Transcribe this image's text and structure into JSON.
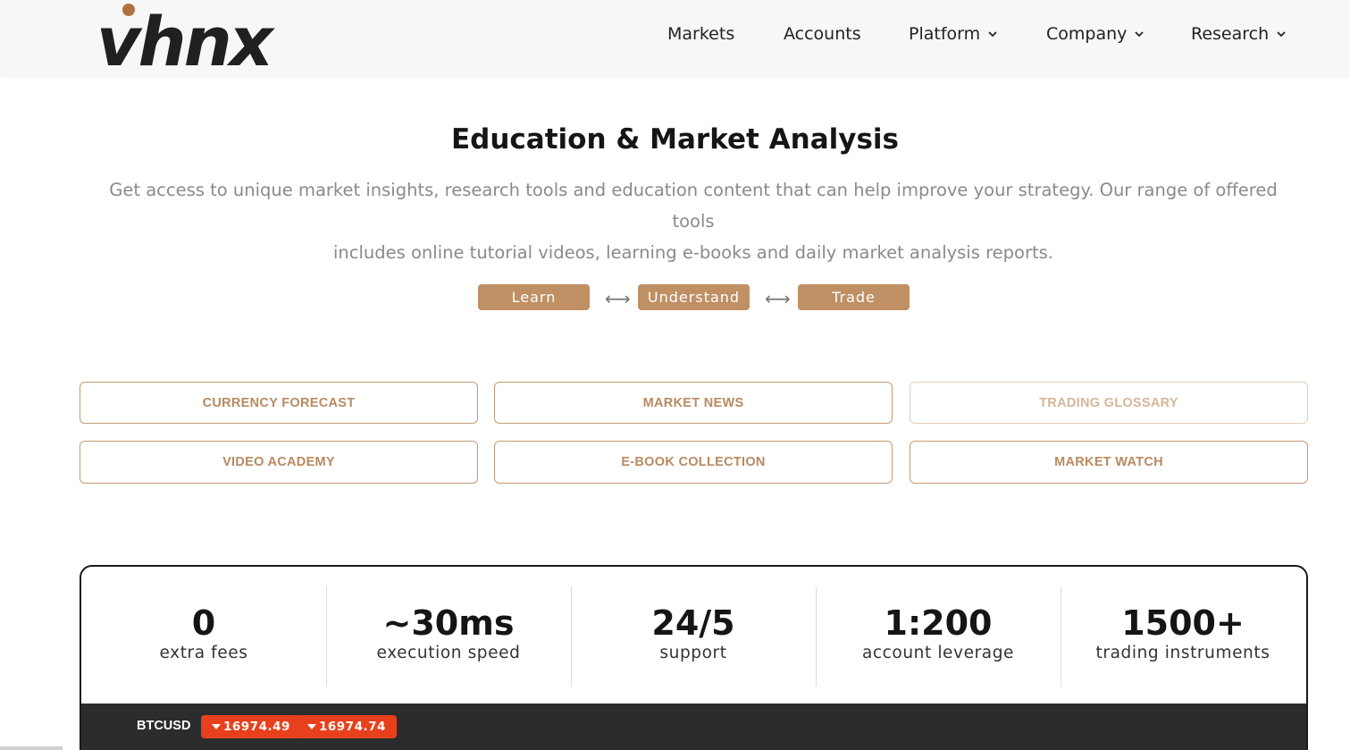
{
  "brand": {
    "logo_text": "vhnx",
    "accent": "#bf9064",
    "dot_color": "#b07040"
  },
  "nav": {
    "items": [
      {
        "label": "Markets",
        "has_dropdown": false
      },
      {
        "label": "Accounts",
        "has_dropdown": false
      },
      {
        "label": "Platform",
        "has_dropdown": true
      },
      {
        "label": "Company",
        "has_dropdown": true
      },
      {
        "label": "Research",
        "has_dropdown": true
      }
    ]
  },
  "hero": {
    "title": "Education & Market Analysis",
    "subtitle_line1": "Get access to unique market insights, research tools and education content that can help improve your strategy. Our range of offered tools",
    "subtitle_line2": "includes online tutorial videos, learning e-books and daily market analysis reports.",
    "steps": [
      "Learn",
      "Understand",
      "Trade"
    ],
    "arrow_glyph": "⟷"
  },
  "tools": [
    {
      "label": "CURRENCY FORECAST"
    },
    {
      "label": "MARKET NEWS"
    },
    {
      "label": "TRADING GLOSSARY"
    },
    {
      "label": "VIDEO ACADEMY"
    },
    {
      "label": "E-BOOK COLLECTION"
    },
    {
      "label": "MARKET WATCH"
    }
  ],
  "stats": [
    {
      "value": "0",
      "label": "extra fees"
    },
    {
      "value": "~30ms",
      "label": "execution speed"
    },
    {
      "value": "24/5",
      "label": "support"
    },
    {
      "value": "1:200",
      "label": "account leverage"
    },
    {
      "value": "1500+",
      "label": "trading instruments"
    }
  ],
  "ticker": {
    "symbol": "BTCUSD",
    "bid": "16974.49",
    "ask": "16974.74",
    "down_color": "#e8401c"
  }
}
